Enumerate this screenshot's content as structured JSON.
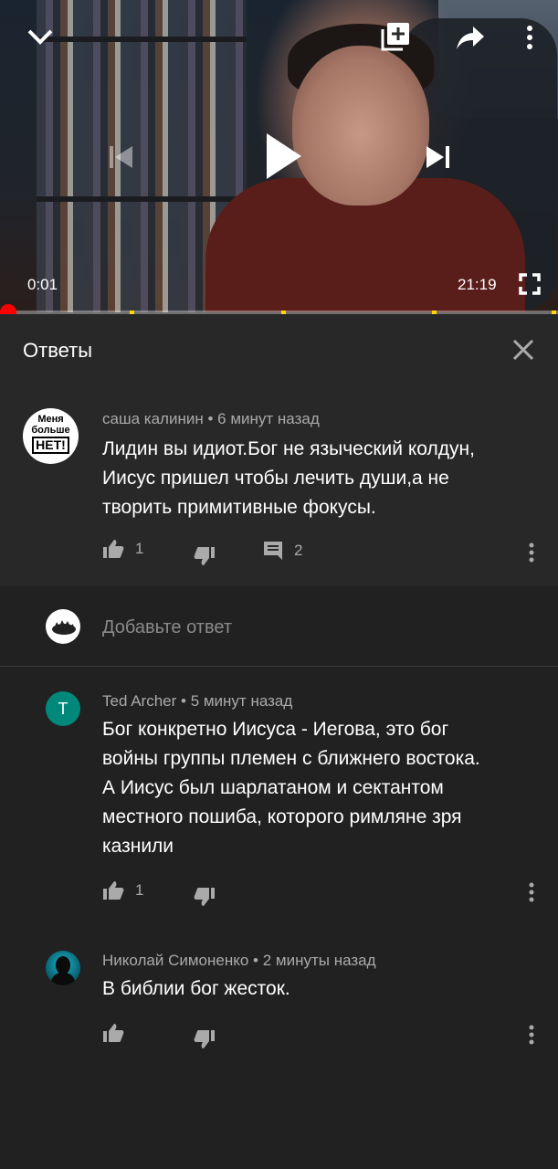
{
  "player": {
    "current_time": "0:01",
    "duration": "21:19",
    "progress_fraction": 0.0008,
    "icons": {
      "collapse": "chevron-down-icon",
      "add_to_playlist": "playlist-add-icon",
      "share": "share-icon",
      "more": "more-vert-icon",
      "previous": "skip-previous-icon",
      "play": "play-icon",
      "next": "skip-next-icon",
      "fullscreen": "fullscreen-icon"
    }
  },
  "replies": {
    "title": "Ответы",
    "close_icon": "close-icon"
  },
  "parent_comment": {
    "author": "саша калинин",
    "time": "6 минут назад",
    "text_lines": [
      "Лидин вы идиот.Бог не языческий колдун,",
      "Иисус пришел чтобы лечить души,а не",
      "творить примитивные фокусы."
    ],
    "avatar_text": [
      "Меня",
      "больше",
      "НЕТ!"
    ],
    "likes": "1",
    "reply_count": "2"
  },
  "add_reply": {
    "placeholder": "Добавьте ответ"
  },
  "comments": [
    {
      "author": "Ted Archer",
      "time": "5 минут назад",
      "avatar_letter": "T",
      "avatar_color": "#00897b",
      "text_lines": [
        "Бог конкретно Иисуса - Иегова, это бог",
        "войны группы племен с ближнего востока.",
        "А Иисус был шарлатаном и сектантом",
        "местного пошиба, которого римляне зря",
        "казнили"
      ],
      "likes": "1"
    },
    {
      "author": "Николай Симоненко",
      "time": "2 минуты назад",
      "text_lines": [
        "В библии бог жесток."
      ],
      "likes": ""
    }
  ],
  "colors": {
    "background": "#212121",
    "card": "#282828",
    "progress": "#ff0000",
    "chapter_marker": "#ffd600",
    "secondary_text": "#aaaaaa"
  }
}
